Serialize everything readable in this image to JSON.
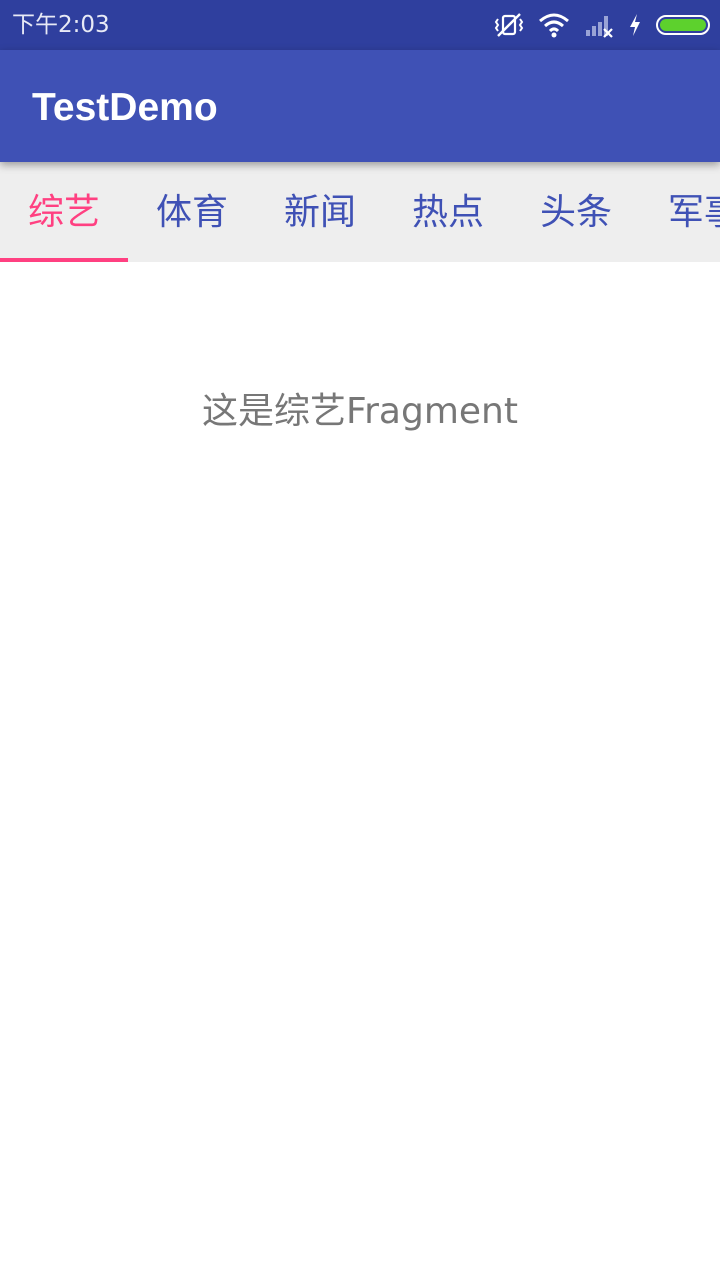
{
  "status_bar": {
    "time": "下午2:03",
    "icons": [
      "vibrate-off-icon",
      "wifi-icon",
      "signal-no-sim-icon",
      "charging-icon",
      "battery-icon"
    ],
    "battery_color": "#5dd12d"
  },
  "app_bar": {
    "title": "TestDemo",
    "color": "#3f51b5"
  },
  "tabs": {
    "selected_index": 0,
    "accent_color": "#ff4081",
    "items": [
      {
        "label": "综艺"
      },
      {
        "label": "体育"
      },
      {
        "label": "新闻"
      },
      {
        "label": "热点"
      },
      {
        "label": "头条"
      },
      {
        "label": "军事"
      }
    ]
  },
  "content": {
    "text": "这是综艺Fragment"
  }
}
